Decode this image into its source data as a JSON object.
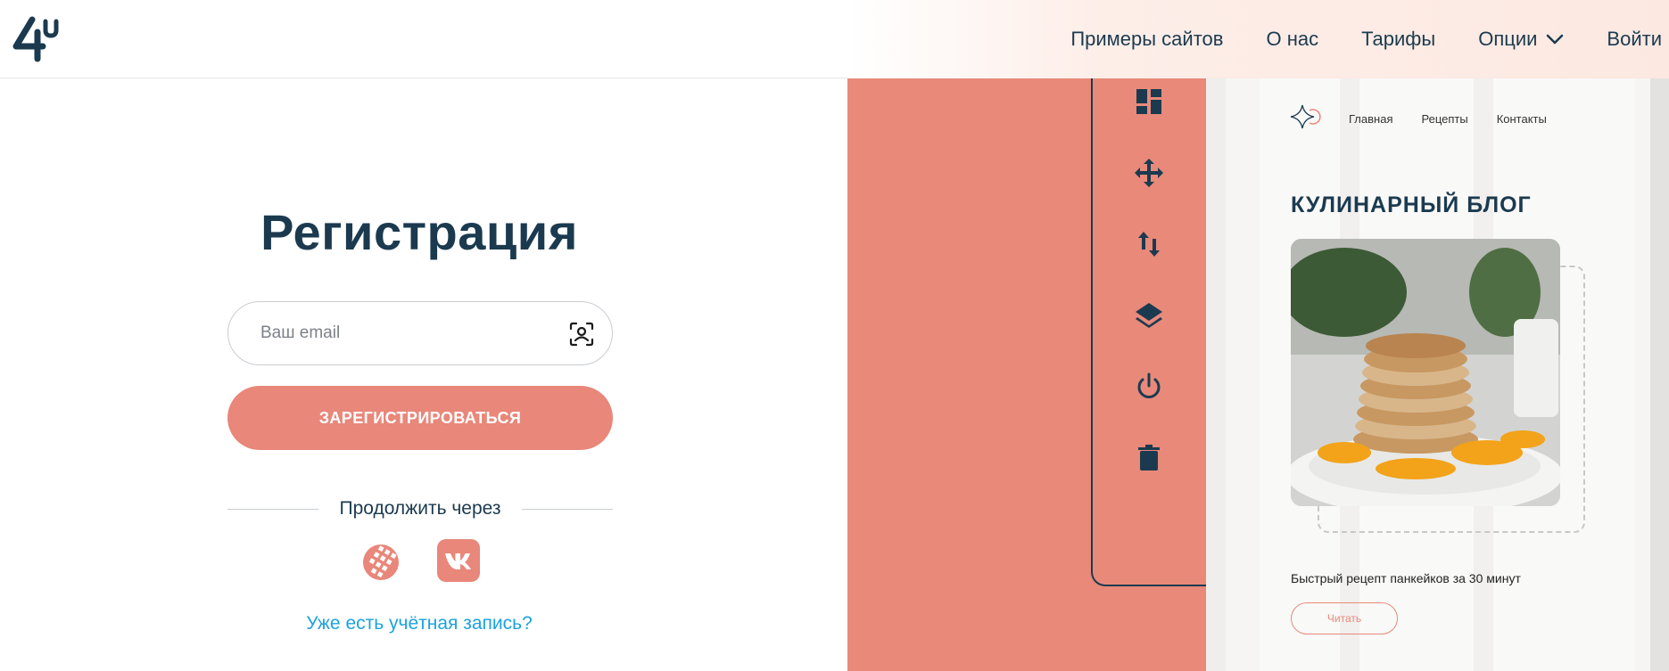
{
  "header": {
    "logo_text": "4u",
    "nav": [
      {
        "label": "Примеры сайтов"
      },
      {
        "label": "О нас"
      },
      {
        "label": "Тарифы"
      },
      {
        "label": "Опции"
      },
      {
        "label": "Войти"
      }
    ]
  },
  "registration": {
    "title": "Регистрация",
    "email_placeholder": "Ваш email",
    "submit_label": "ЗАРЕГИСТРИРОВАТЬСЯ",
    "continue_with": "Продолжить через",
    "social": [
      "webmoney-icon",
      "vk-icon"
    ],
    "login_link": "Уже есть учётная запись?"
  },
  "preview": {
    "nav": [
      "Главная",
      "Рецепты",
      "Контакты"
    ],
    "title": "КУЛИНАРНЫЙ БЛОГ",
    "caption": "Быстрый рецепт панкейков за 30 минут",
    "read_label": "Читать"
  },
  "toolbar_icons": [
    "dashboard-icon",
    "move-icon",
    "sort-icon",
    "layers-icon",
    "power-icon",
    "trash-icon"
  ],
  "colors": {
    "accent": "#e8877a",
    "primary": "#1b3a4f",
    "link": "#1ba3e0"
  }
}
